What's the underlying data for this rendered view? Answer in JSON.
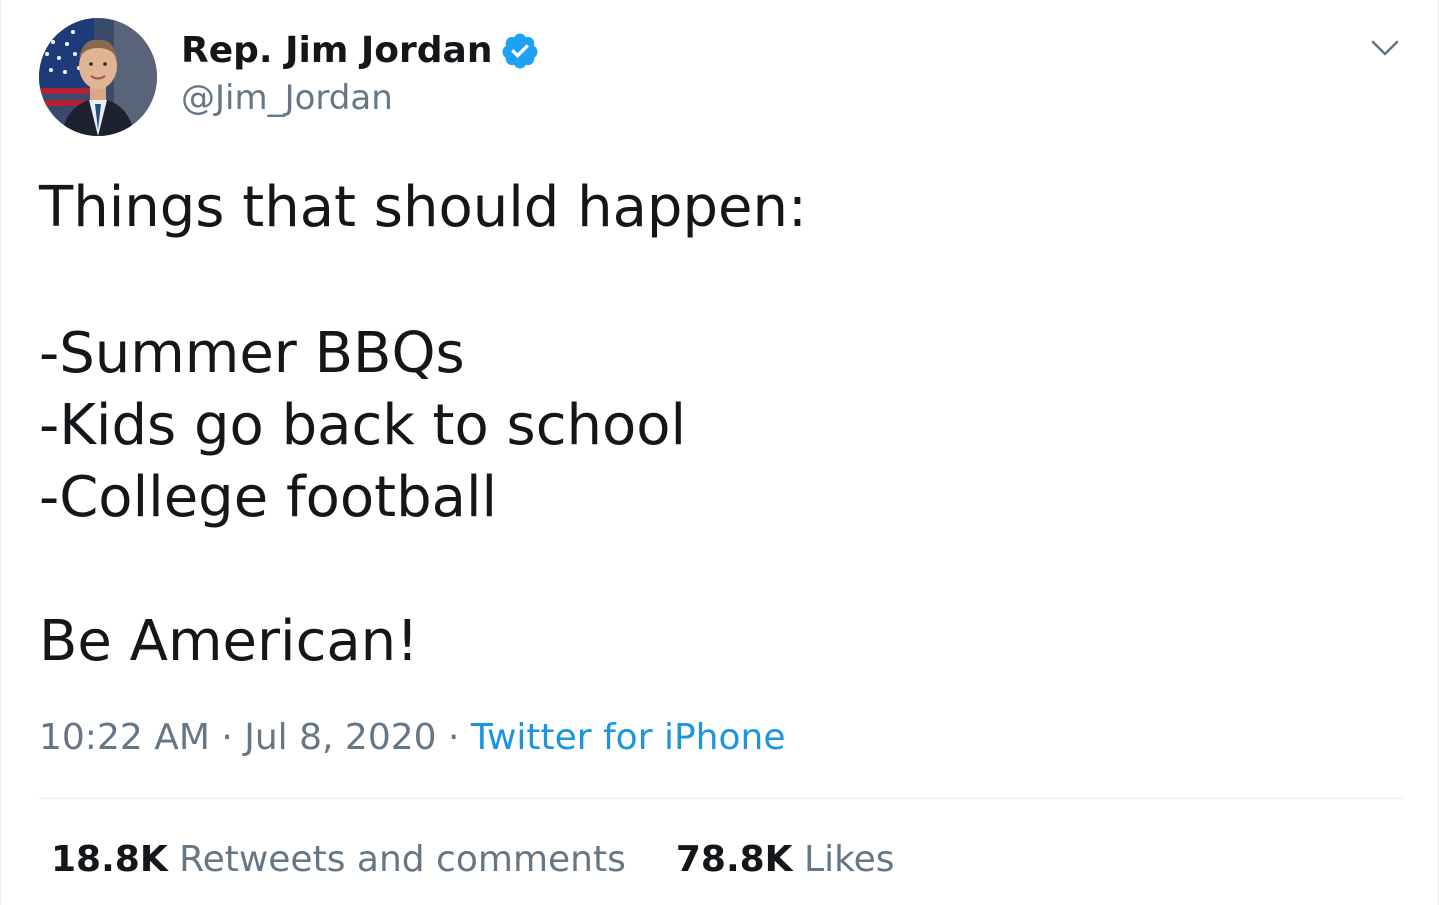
{
  "author": {
    "display_name": "Rep. Jim Jordan",
    "handle": "@Jim_Jordan",
    "verified": true,
    "avatar_icon": "profile-photo"
  },
  "tweet": {
    "lines": [
      "Things that should happen:",
      "-Summer BBQs",
      "-Kids go back to school",
      "-College football",
      "Be American!"
    ]
  },
  "meta": {
    "time": "10:22 AM",
    "separator": "·",
    "date": "Jul 8, 2020",
    "source": "Twitter for iPhone"
  },
  "stats": {
    "retweets_count": "18.8K",
    "retweets_label": "Retweets and comments",
    "likes_count": "78.8K",
    "likes_label": "Likes"
  },
  "colors": {
    "text": "#14171a",
    "secondary": "#657786",
    "link": "#1b95e0",
    "verified": "#1da1f2",
    "divider": "#e6ecf0"
  },
  "icons": {
    "verified": "verified-badge-icon",
    "menu": "chevron-down-icon"
  }
}
